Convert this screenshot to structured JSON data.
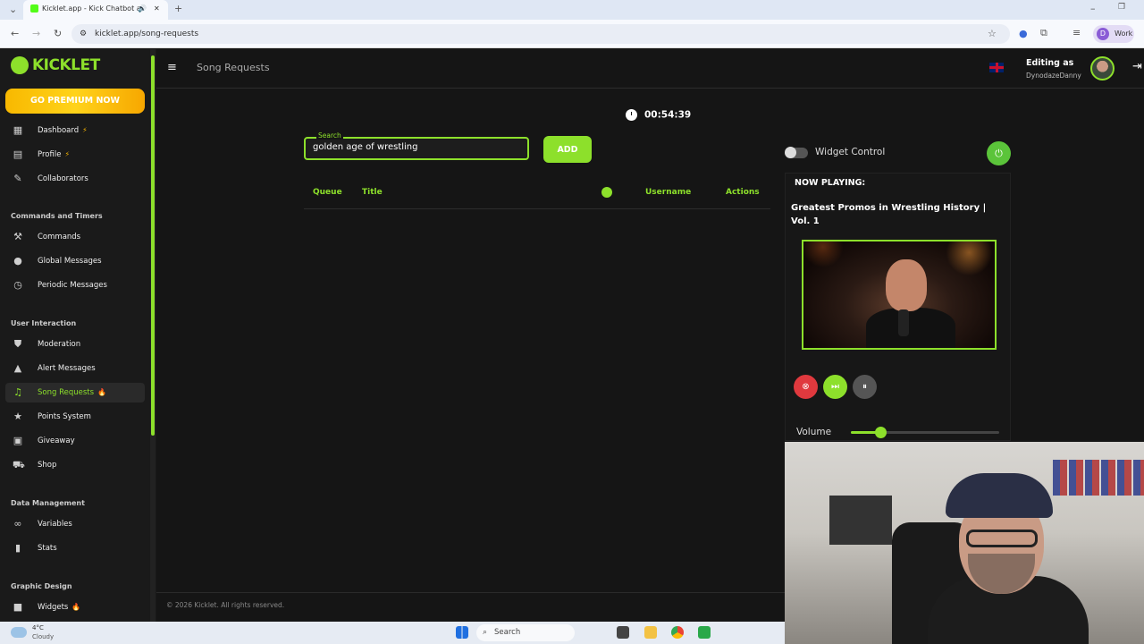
{
  "browser": {
    "tab_title": "Kicklet.app - Kick Chatbot a",
    "url": "kicklet.app/song-requests",
    "profile_label": "Work",
    "profile_initial": "D"
  },
  "sidebar": {
    "brand": "KICKLET",
    "premium_label": "GO PREMIUM NOW",
    "items_top": [
      {
        "label": "Dashboard",
        "icon": "dashboard-icon",
        "badge": "⚡"
      },
      {
        "label": "Profile",
        "icon": "profile-icon",
        "badge": "⚡"
      },
      {
        "label": "Collaborators",
        "icon": "collaborators-icon"
      }
    ],
    "section_commands": "Commands and Timers",
    "items_commands": [
      {
        "label": "Commands",
        "icon": "hammer-icon"
      },
      {
        "label": "Global Messages",
        "icon": "chat-bubble-icon"
      },
      {
        "label": "Periodic Messages",
        "icon": "clock-icon"
      }
    ],
    "section_interaction": "User Interaction",
    "items_interaction": [
      {
        "label": "Moderation",
        "icon": "shield-icon"
      },
      {
        "label": "Alert Messages",
        "icon": "warning-icon"
      },
      {
        "label": "Song Requests",
        "icon": "music-note-icon",
        "badge": "🔥",
        "active": true
      },
      {
        "label": "Points System",
        "icon": "star-icon"
      },
      {
        "label": "Giveaway",
        "icon": "gift-icon"
      },
      {
        "label": "Shop",
        "icon": "cart-icon"
      }
    ],
    "section_data": "Data Management",
    "items_data": [
      {
        "label": "Variables",
        "icon": "link-icon"
      },
      {
        "label": "Stats",
        "icon": "bar-chart-icon"
      }
    ],
    "section_graphic": "Graphic Design",
    "items_graphic": [
      {
        "label": "Widgets",
        "icon": "camera-icon",
        "badge": "🔥"
      }
    ]
  },
  "header": {
    "page_title": "Song Requests",
    "editing_label": "Editing as",
    "username": "DynodazeDanny"
  },
  "main": {
    "timer": "00:54:39",
    "search_label": "Search",
    "search_value": "golden age of wrestling",
    "add_label": "ADD",
    "columns": {
      "queue": "Queue",
      "title": "Title",
      "username": "Username",
      "actions": "Actions"
    },
    "footer": "© 2026 Kicklet. All rights reserved."
  },
  "widget": {
    "control_label": "Widget Control",
    "now_playing_label": "NOW PLAYING:",
    "now_playing_title": "Greatest Promos in Wrestling History | Vol. 1",
    "volume_label": "Volume",
    "volume_level": 0.2
  },
  "taskbar": {
    "weather_temp": "4°C",
    "weather_desc": "Cloudy",
    "search_label": "Search"
  },
  "colors": {
    "accent": "#8de02b",
    "premium": "#f8b800",
    "stop": "#e0393e",
    "background": "#151515"
  }
}
